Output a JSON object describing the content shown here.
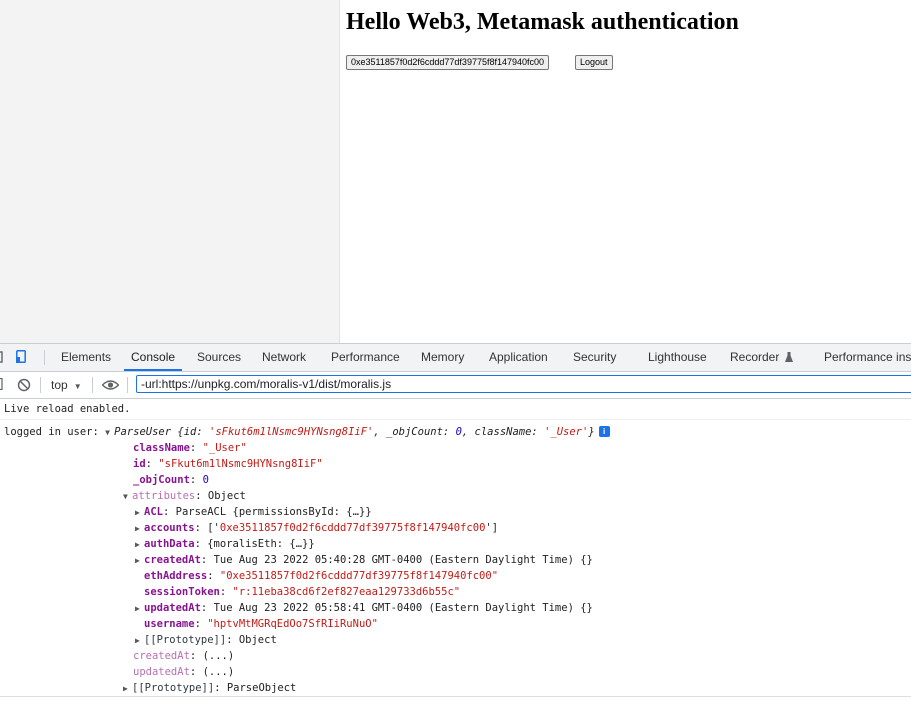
{
  "page": {
    "title": "Hello Web3, Metamask authentication",
    "address_button": "0xe3511857f0d2f6cddd77df39775f8f147940fc00",
    "logout_button": "Logout"
  },
  "devtools": {
    "tabs": [
      "Elements",
      "Console",
      "Sources",
      "Network",
      "Performance",
      "Memory",
      "Application",
      "Security",
      "Lighthouse",
      "Recorder",
      "Performance insi"
    ],
    "active_tab": "Console",
    "context": "top",
    "filter_value": "-url:https://unpkg.com/moralis-v1/dist/moralis.js"
  },
  "console": {
    "live_reload": "Live reload enabled.",
    "log_prefix": "logged in user:",
    "object_type": "ParseUser",
    "summary": {
      "open": "{id: ",
      "id": "'sFkut6m1lNsmc9HYNsng8IiF'",
      "objcount_label": ", _objCount: ",
      "objcount": "0",
      "classname_label": ", className: ",
      "classname": "'_User'",
      "close": "}"
    },
    "info_badge": "i",
    "props": {
      "className_key": "className",
      "className_val": "\"_User\"",
      "id_key": "id",
      "id_val": "\"sFkut6m1lNsmc9HYNsng8IiF\"",
      "objCount_key": "_objCount",
      "objCount_val": "0",
      "attributes_key": "attributes",
      "attributes_val": "Object"
    },
    "attributes": {
      "acl_key": "ACL",
      "acl_val": "ParseACL {permissionsById: {…}}",
      "accounts_key": "accounts",
      "accounts_open": "['",
      "accounts_val": "0xe3511857f0d2f6cddd77df39775f8f147940fc00",
      "accounts_close": "']",
      "authData_key": "authData",
      "authData_val": "{moralisEth: {…}}",
      "createdAt_key": "createdAt",
      "createdAt_val": "Tue Aug 23 2022 05:40:28 GMT-0400 (Eastern Daylight Time) {}",
      "ethAddress_key": "ethAddress",
      "ethAddress_val": "\"0xe3511857f0d2f6cddd77df39775f8f147940fc00\"",
      "sessionToken_key": "sessionToken",
      "sessionToken_val": "\"r:11eba38cd6f2ef827eaa129733d6b55c\"",
      "updatedAt_key": "updatedAt",
      "updatedAt_val": "Tue Aug 23 2022 05:58:41 GMT-0400 (Eastern Daylight Time) {}",
      "username_key": "username",
      "username_val": "\"hptvMtMGRqEdOo7SfRIiRuNuO\"",
      "proto_key": "[[Prototype]]",
      "proto_val": "Object"
    },
    "getters": {
      "createdAt_key": "createdAt",
      "updatedAt_key": "updatedAt",
      "lazy_val": "(...)"
    },
    "proto_key": "[[Prototype]]",
    "proto_val": "ParseObject"
  }
}
